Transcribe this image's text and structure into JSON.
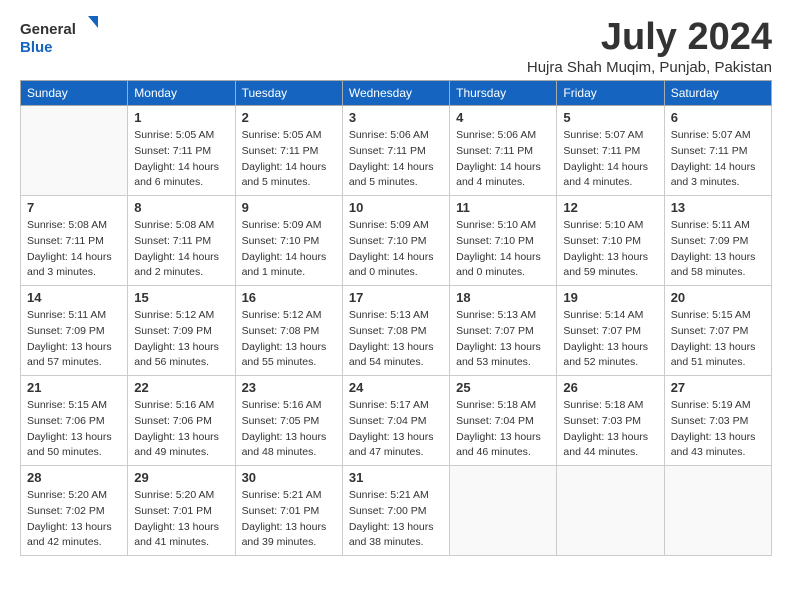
{
  "header": {
    "logo_line1": "General",
    "logo_line2": "Blue",
    "month_title": "July 2024",
    "location": "Hujra Shah Muqim, Punjab, Pakistan"
  },
  "days_of_week": [
    "Sunday",
    "Monday",
    "Tuesday",
    "Wednesday",
    "Thursday",
    "Friday",
    "Saturday"
  ],
  "weeks": [
    [
      {
        "day": "",
        "sunrise": "",
        "sunset": "",
        "daylight": "",
        "empty": true
      },
      {
        "day": "1",
        "sunrise": "Sunrise: 5:05 AM",
        "sunset": "Sunset: 7:11 PM",
        "daylight": "Daylight: 14 hours and 6 minutes."
      },
      {
        "day": "2",
        "sunrise": "Sunrise: 5:05 AM",
        "sunset": "Sunset: 7:11 PM",
        "daylight": "Daylight: 14 hours and 5 minutes."
      },
      {
        "day": "3",
        "sunrise": "Sunrise: 5:06 AM",
        "sunset": "Sunset: 7:11 PM",
        "daylight": "Daylight: 14 hours and 5 minutes."
      },
      {
        "day": "4",
        "sunrise": "Sunrise: 5:06 AM",
        "sunset": "Sunset: 7:11 PM",
        "daylight": "Daylight: 14 hours and 4 minutes."
      },
      {
        "day": "5",
        "sunrise": "Sunrise: 5:07 AM",
        "sunset": "Sunset: 7:11 PM",
        "daylight": "Daylight: 14 hours and 4 minutes."
      },
      {
        "day": "6",
        "sunrise": "Sunrise: 5:07 AM",
        "sunset": "Sunset: 7:11 PM",
        "daylight": "Daylight: 14 hours and 3 minutes."
      }
    ],
    [
      {
        "day": "7",
        "sunrise": "Sunrise: 5:08 AM",
        "sunset": "Sunset: 7:11 PM",
        "daylight": "Daylight: 14 hours and 3 minutes."
      },
      {
        "day": "8",
        "sunrise": "Sunrise: 5:08 AM",
        "sunset": "Sunset: 7:11 PM",
        "daylight": "Daylight: 14 hours and 2 minutes."
      },
      {
        "day": "9",
        "sunrise": "Sunrise: 5:09 AM",
        "sunset": "Sunset: 7:10 PM",
        "daylight": "Daylight: 14 hours and 1 minute."
      },
      {
        "day": "10",
        "sunrise": "Sunrise: 5:09 AM",
        "sunset": "Sunset: 7:10 PM",
        "daylight": "Daylight: 14 hours and 0 minutes."
      },
      {
        "day": "11",
        "sunrise": "Sunrise: 5:10 AM",
        "sunset": "Sunset: 7:10 PM",
        "daylight": "Daylight: 14 hours and 0 minutes."
      },
      {
        "day": "12",
        "sunrise": "Sunrise: 5:10 AM",
        "sunset": "Sunset: 7:10 PM",
        "daylight": "Daylight: 13 hours and 59 minutes."
      },
      {
        "day": "13",
        "sunrise": "Sunrise: 5:11 AM",
        "sunset": "Sunset: 7:09 PM",
        "daylight": "Daylight: 13 hours and 58 minutes."
      }
    ],
    [
      {
        "day": "14",
        "sunrise": "Sunrise: 5:11 AM",
        "sunset": "Sunset: 7:09 PM",
        "daylight": "Daylight: 13 hours and 57 minutes."
      },
      {
        "day": "15",
        "sunrise": "Sunrise: 5:12 AM",
        "sunset": "Sunset: 7:09 PM",
        "daylight": "Daylight: 13 hours and 56 minutes."
      },
      {
        "day": "16",
        "sunrise": "Sunrise: 5:12 AM",
        "sunset": "Sunset: 7:08 PM",
        "daylight": "Daylight: 13 hours and 55 minutes."
      },
      {
        "day": "17",
        "sunrise": "Sunrise: 5:13 AM",
        "sunset": "Sunset: 7:08 PM",
        "daylight": "Daylight: 13 hours and 54 minutes."
      },
      {
        "day": "18",
        "sunrise": "Sunrise: 5:13 AM",
        "sunset": "Sunset: 7:07 PM",
        "daylight": "Daylight: 13 hours and 53 minutes."
      },
      {
        "day": "19",
        "sunrise": "Sunrise: 5:14 AM",
        "sunset": "Sunset: 7:07 PM",
        "daylight": "Daylight: 13 hours and 52 minutes."
      },
      {
        "day": "20",
        "sunrise": "Sunrise: 5:15 AM",
        "sunset": "Sunset: 7:07 PM",
        "daylight": "Daylight: 13 hours and 51 minutes."
      }
    ],
    [
      {
        "day": "21",
        "sunrise": "Sunrise: 5:15 AM",
        "sunset": "Sunset: 7:06 PM",
        "daylight": "Daylight: 13 hours and 50 minutes."
      },
      {
        "day": "22",
        "sunrise": "Sunrise: 5:16 AM",
        "sunset": "Sunset: 7:06 PM",
        "daylight": "Daylight: 13 hours and 49 minutes."
      },
      {
        "day": "23",
        "sunrise": "Sunrise: 5:16 AM",
        "sunset": "Sunset: 7:05 PM",
        "daylight": "Daylight: 13 hours and 48 minutes."
      },
      {
        "day": "24",
        "sunrise": "Sunrise: 5:17 AM",
        "sunset": "Sunset: 7:04 PM",
        "daylight": "Daylight: 13 hours and 47 minutes."
      },
      {
        "day": "25",
        "sunrise": "Sunrise: 5:18 AM",
        "sunset": "Sunset: 7:04 PM",
        "daylight": "Daylight: 13 hours and 46 minutes."
      },
      {
        "day": "26",
        "sunrise": "Sunrise: 5:18 AM",
        "sunset": "Sunset: 7:03 PM",
        "daylight": "Daylight: 13 hours and 44 minutes."
      },
      {
        "day": "27",
        "sunrise": "Sunrise: 5:19 AM",
        "sunset": "Sunset: 7:03 PM",
        "daylight": "Daylight: 13 hours and 43 minutes."
      }
    ],
    [
      {
        "day": "28",
        "sunrise": "Sunrise: 5:20 AM",
        "sunset": "Sunset: 7:02 PM",
        "daylight": "Daylight: 13 hours and 42 minutes."
      },
      {
        "day": "29",
        "sunrise": "Sunrise: 5:20 AM",
        "sunset": "Sunset: 7:01 PM",
        "daylight": "Daylight: 13 hours and 41 minutes."
      },
      {
        "day": "30",
        "sunrise": "Sunrise: 5:21 AM",
        "sunset": "Sunset: 7:01 PM",
        "daylight": "Daylight: 13 hours and 39 minutes."
      },
      {
        "day": "31",
        "sunrise": "Sunrise: 5:21 AM",
        "sunset": "Sunset: 7:00 PM",
        "daylight": "Daylight: 13 hours and 38 minutes."
      },
      {
        "day": "",
        "sunrise": "",
        "sunset": "",
        "daylight": "",
        "empty": true
      },
      {
        "day": "",
        "sunrise": "",
        "sunset": "",
        "daylight": "",
        "empty": true
      },
      {
        "day": "",
        "sunrise": "",
        "sunset": "",
        "daylight": "",
        "empty": true
      }
    ]
  ]
}
